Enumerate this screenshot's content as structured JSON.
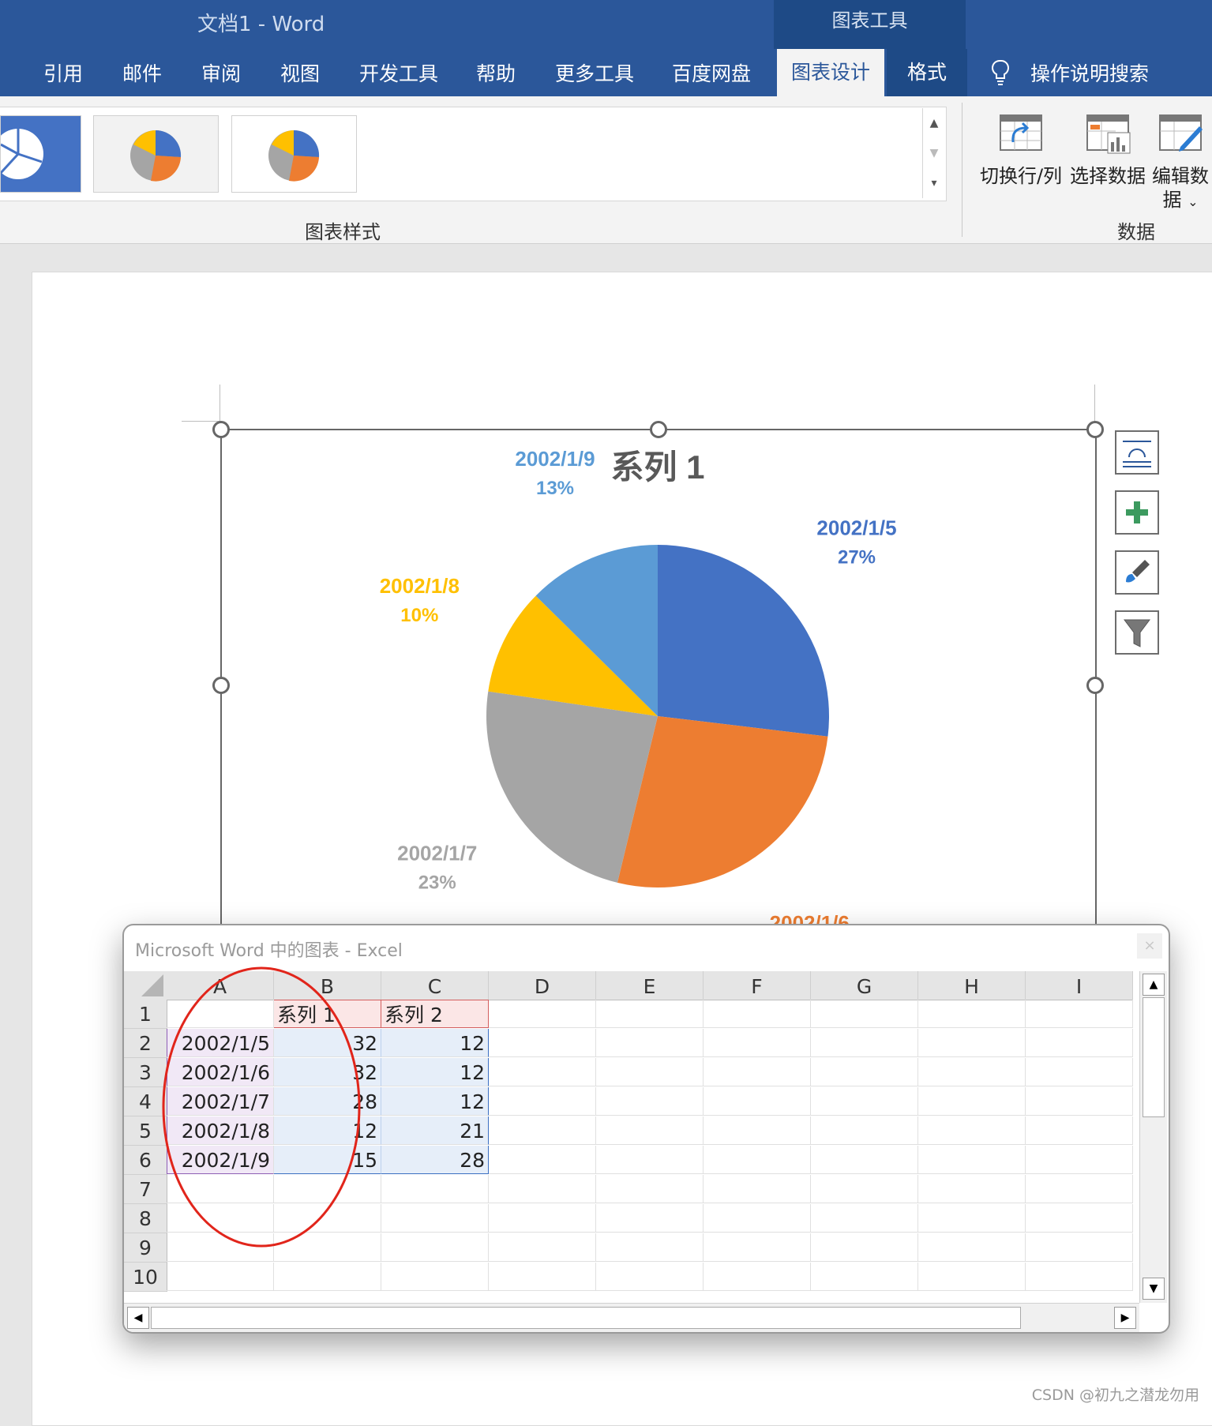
{
  "window": {
    "doc_title": "文档1  -  Word",
    "context_tab_group": "图表工具"
  },
  "tabs": [
    {
      "label": "引用"
    },
    {
      "label": "邮件"
    },
    {
      "label": "审阅"
    },
    {
      "label": "视图"
    },
    {
      "label": "开发工具"
    },
    {
      "label": "帮助"
    },
    {
      "label": "更多工具"
    },
    {
      "label": "百度网盘"
    },
    {
      "label": "图表设计",
      "active": true
    },
    {
      "label": "格式"
    }
  ],
  "search_label": "操作说明搜索",
  "ribbon": {
    "styles_group_label": "图表样式",
    "data_group_label": "数据",
    "switch_row_col": "切换行/列",
    "select_data": "选择数据",
    "edit_data_line1": "编辑数",
    "edit_data_line2": "据"
  },
  "chart_data": {
    "type": "pie",
    "title": "系列 1",
    "categories": [
      "2002/1/5",
      "2002/1/6",
      "2002/1/7",
      "2002/1/8",
      "2002/1/9"
    ],
    "values": [
      32,
      32,
      28,
      12,
      15
    ],
    "percent_labels": [
      "27%",
      "27%",
      "23%",
      "10%",
      "13%"
    ],
    "colors": [
      "#4472c4",
      "#ed7d31",
      "#a5a5a5",
      "#ffc000",
      "#5b9bd5"
    ]
  },
  "excel": {
    "title": "Microsoft Word 中的图表 - Excel",
    "close": "×",
    "columns": [
      "A",
      "B",
      "C",
      "D",
      "E",
      "F",
      "G",
      "H",
      "I"
    ],
    "rows": [
      "1",
      "2",
      "3",
      "4",
      "5",
      "6",
      "7",
      "8",
      "9",
      "10"
    ],
    "header_row": [
      "",
      "系列 1",
      "系列 2"
    ],
    "data_rows": [
      [
        "2002/1/5",
        "32",
        "12"
      ],
      [
        "2002/1/6",
        "32",
        "12"
      ],
      [
        "2002/1/7",
        "28",
        "12"
      ],
      [
        "2002/1/8",
        "12",
        "21"
      ],
      [
        "2002/1/9",
        "15",
        "28"
      ]
    ]
  },
  "watermark": "CSDN @初九之潜龙勿用"
}
